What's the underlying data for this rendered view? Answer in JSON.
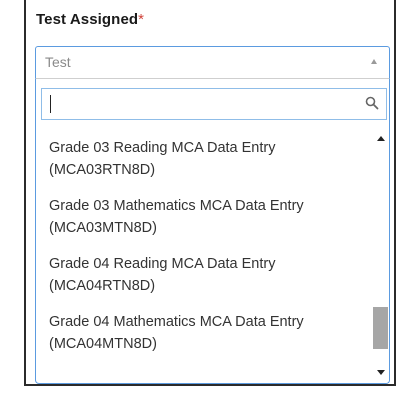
{
  "field": {
    "label": "Test Assigned",
    "required_mark": "*"
  },
  "select": {
    "selected_value": "Test"
  },
  "search": {
    "value": "",
    "placeholder": ""
  },
  "options": [
    {
      "line1": "Grade 03 Reading MCA Data Entry",
      "line2": "(MCA03RTN8D)"
    },
    {
      "line1": "Grade 03 Mathematics MCA Data Entry",
      "line2": "(MCA03MTN8D)"
    },
    {
      "line1": "Grade 04 Reading MCA Data Entry",
      "line2": "(MCA04RTN8D)"
    },
    {
      "line1": "Grade 04 Mathematics MCA Data Entry",
      "line2": "(MCA04MTN8D)"
    }
  ],
  "scroll": {
    "position_fraction": 0.92
  },
  "colors": {
    "focus_border": "#5b9be0",
    "required": "#d0433a",
    "scroll_thumb": "#a6a6a6"
  }
}
